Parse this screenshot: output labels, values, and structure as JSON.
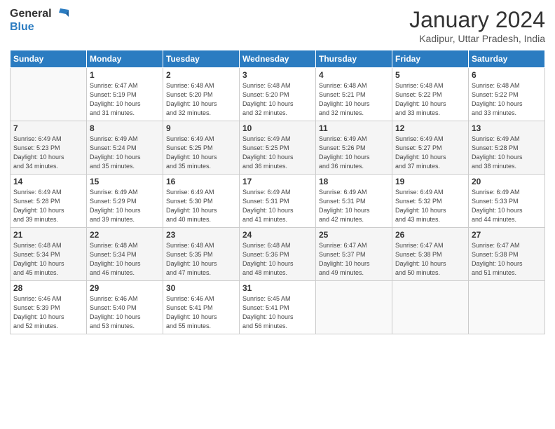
{
  "header": {
    "logo_line1": "General",
    "logo_line2": "Blue",
    "title": "January 2024",
    "subtitle": "Kadipur, Uttar Pradesh, India"
  },
  "weekdays": [
    "Sunday",
    "Monday",
    "Tuesday",
    "Wednesday",
    "Thursday",
    "Friday",
    "Saturday"
  ],
  "weeks": [
    [
      {
        "day": "",
        "info": ""
      },
      {
        "day": "1",
        "info": "Sunrise: 6:47 AM\nSunset: 5:19 PM\nDaylight: 10 hours\nand 31 minutes."
      },
      {
        "day": "2",
        "info": "Sunrise: 6:48 AM\nSunset: 5:20 PM\nDaylight: 10 hours\nand 32 minutes."
      },
      {
        "day": "3",
        "info": "Sunrise: 6:48 AM\nSunset: 5:20 PM\nDaylight: 10 hours\nand 32 minutes."
      },
      {
        "day": "4",
        "info": "Sunrise: 6:48 AM\nSunset: 5:21 PM\nDaylight: 10 hours\nand 32 minutes."
      },
      {
        "day": "5",
        "info": "Sunrise: 6:48 AM\nSunset: 5:22 PM\nDaylight: 10 hours\nand 33 minutes."
      },
      {
        "day": "6",
        "info": "Sunrise: 6:48 AM\nSunset: 5:22 PM\nDaylight: 10 hours\nand 33 minutes."
      }
    ],
    [
      {
        "day": "7",
        "info": "Sunrise: 6:49 AM\nSunset: 5:23 PM\nDaylight: 10 hours\nand 34 minutes."
      },
      {
        "day": "8",
        "info": "Sunrise: 6:49 AM\nSunset: 5:24 PM\nDaylight: 10 hours\nand 35 minutes."
      },
      {
        "day": "9",
        "info": "Sunrise: 6:49 AM\nSunset: 5:25 PM\nDaylight: 10 hours\nand 35 minutes."
      },
      {
        "day": "10",
        "info": "Sunrise: 6:49 AM\nSunset: 5:25 PM\nDaylight: 10 hours\nand 36 minutes."
      },
      {
        "day": "11",
        "info": "Sunrise: 6:49 AM\nSunset: 5:26 PM\nDaylight: 10 hours\nand 36 minutes."
      },
      {
        "day": "12",
        "info": "Sunrise: 6:49 AM\nSunset: 5:27 PM\nDaylight: 10 hours\nand 37 minutes."
      },
      {
        "day": "13",
        "info": "Sunrise: 6:49 AM\nSunset: 5:28 PM\nDaylight: 10 hours\nand 38 minutes."
      }
    ],
    [
      {
        "day": "14",
        "info": "Sunrise: 6:49 AM\nSunset: 5:28 PM\nDaylight: 10 hours\nand 39 minutes."
      },
      {
        "day": "15",
        "info": "Sunrise: 6:49 AM\nSunset: 5:29 PM\nDaylight: 10 hours\nand 39 minutes."
      },
      {
        "day": "16",
        "info": "Sunrise: 6:49 AM\nSunset: 5:30 PM\nDaylight: 10 hours\nand 40 minutes."
      },
      {
        "day": "17",
        "info": "Sunrise: 6:49 AM\nSunset: 5:31 PM\nDaylight: 10 hours\nand 41 minutes."
      },
      {
        "day": "18",
        "info": "Sunrise: 6:49 AM\nSunset: 5:31 PM\nDaylight: 10 hours\nand 42 minutes."
      },
      {
        "day": "19",
        "info": "Sunrise: 6:49 AM\nSunset: 5:32 PM\nDaylight: 10 hours\nand 43 minutes."
      },
      {
        "day": "20",
        "info": "Sunrise: 6:49 AM\nSunset: 5:33 PM\nDaylight: 10 hours\nand 44 minutes."
      }
    ],
    [
      {
        "day": "21",
        "info": "Sunrise: 6:48 AM\nSunset: 5:34 PM\nDaylight: 10 hours\nand 45 minutes."
      },
      {
        "day": "22",
        "info": "Sunrise: 6:48 AM\nSunset: 5:34 PM\nDaylight: 10 hours\nand 46 minutes."
      },
      {
        "day": "23",
        "info": "Sunrise: 6:48 AM\nSunset: 5:35 PM\nDaylight: 10 hours\nand 47 minutes."
      },
      {
        "day": "24",
        "info": "Sunrise: 6:48 AM\nSunset: 5:36 PM\nDaylight: 10 hours\nand 48 minutes."
      },
      {
        "day": "25",
        "info": "Sunrise: 6:47 AM\nSunset: 5:37 PM\nDaylight: 10 hours\nand 49 minutes."
      },
      {
        "day": "26",
        "info": "Sunrise: 6:47 AM\nSunset: 5:38 PM\nDaylight: 10 hours\nand 50 minutes."
      },
      {
        "day": "27",
        "info": "Sunrise: 6:47 AM\nSunset: 5:38 PM\nDaylight: 10 hours\nand 51 minutes."
      }
    ],
    [
      {
        "day": "28",
        "info": "Sunrise: 6:46 AM\nSunset: 5:39 PM\nDaylight: 10 hours\nand 52 minutes."
      },
      {
        "day": "29",
        "info": "Sunrise: 6:46 AM\nSunset: 5:40 PM\nDaylight: 10 hours\nand 53 minutes."
      },
      {
        "day": "30",
        "info": "Sunrise: 6:46 AM\nSunset: 5:41 PM\nDaylight: 10 hours\nand 55 minutes."
      },
      {
        "day": "31",
        "info": "Sunrise: 6:45 AM\nSunset: 5:41 PM\nDaylight: 10 hours\nand 56 minutes."
      },
      {
        "day": "",
        "info": ""
      },
      {
        "day": "",
        "info": ""
      },
      {
        "day": "",
        "info": ""
      }
    ]
  ]
}
